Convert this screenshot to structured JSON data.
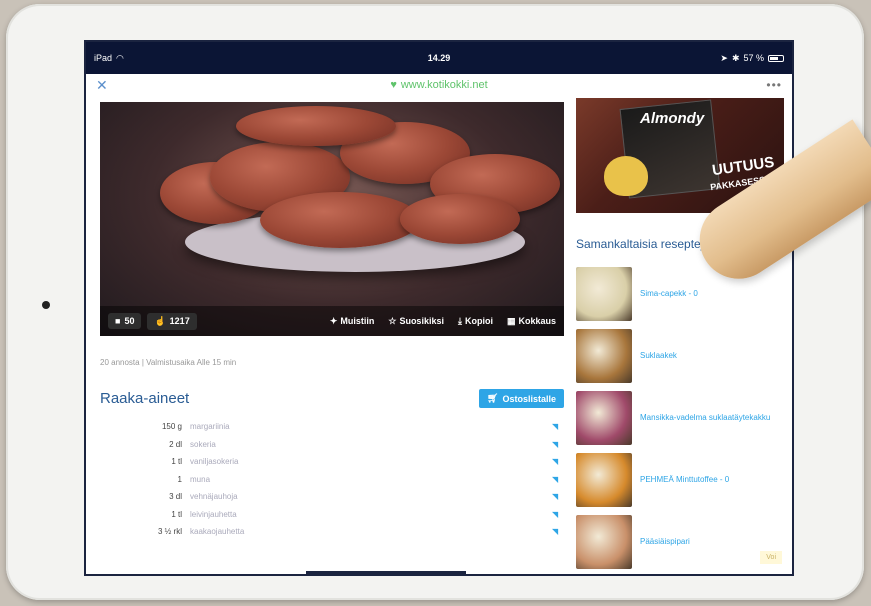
{
  "status_bar": {
    "device": "iPad",
    "time": "14.29",
    "battery": "57 %",
    "battery_level": 0.57
  },
  "browser": {
    "url": "www.kotikokki.net"
  },
  "recipe": {
    "comments_count": "50",
    "likes_count": "1217",
    "actions": {
      "save": "Muistiin",
      "favorite": "Suosikiksi",
      "copy": "Kopioi",
      "cook": "Kokkaus"
    },
    "meta": "20 annosta | Valmistusaika Alle 15 min",
    "ingredients_title": "Raaka-aineet",
    "shopping_button": "Ostoslistalle",
    "ingredients": [
      {
        "qty": "150 g",
        "name": "margariinia"
      },
      {
        "qty": "2 dl",
        "name": "sokeria"
      },
      {
        "qty": "1 tl",
        "name": "vaniljasokeria"
      },
      {
        "qty": "1",
        "name": "muna"
      },
      {
        "qty": "3 dl",
        "name": "vehnäjauhoja"
      },
      {
        "qty": "1 tl",
        "name": "leivinjauhetta"
      },
      {
        "qty": "3 ½ rkl",
        "name": "kaakaojauhetta"
      }
    ]
  },
  "ad": {
    "brand": "Almondy",
    "headline": "UUTUUS",
    "subline": "PAKKASESSA"
  },
  "similar": {
    "title": "Samankaltaisia reseptejä",
    "items": [
      {
        "label": "Sima-capekk - 0",
        "color": "#d9cfa8"
      },
      {
        "label": "Suklaakek",
        "color": "#a8763c"
      },
      {
        "label": "Mansikka-vadelma suklaatäytekakku",
        "color": "#a04a6a"
      },
      {
        "label": "PEHMEÄ Minttutoffee - 0",
        "color": "#d68a2c"
      },
      {
        "label": "Pääsiäispipari",
        "color": "#c9906a"
      }
    ]
  },
  "corner_badge": "Voi",
  "colors": {
    "status_bg": "#0b1535",
    "accent_blue": "#2ea5e6",
    "heading_blue": "#2a5c94",
    "url_green": "#5fc36b"
  }
}
